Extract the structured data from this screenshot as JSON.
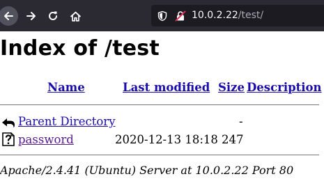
{
  "browser": {
    "url_host": "10.0.2.22",
    "url_path": "/test/"
  },
  "page": {
    "title": "Index of /test",
    "columns": {
      "name": "Name",
      "last_modified": "Last modified",
      "size": "Size",
      "description": "Description"
    },
    "rows": [
      {
        "icon": "back-arrow-icon",
        "name": "Parent Directory",
        "last_modified": "",
        "size": "-",
        "description": ""
      },
      {
        "icon": "unknown-file-icon",
        "name": "password",
        "last_modified": "2020-12-13 18:18",
        "size": "247",
        "description": ""
      }
    ],
    "footer": "Apache/2.4.41 (Ubuntu) Server at 10.0.2.22 Port 80"
  },
  "colors": {
    "toolbar_bg": "#2b2a33",
    "urlbar_bg": "#1c1b22",
    "link": "#1a0dab",
    "link_visited": "#551a8b"
  }
}
